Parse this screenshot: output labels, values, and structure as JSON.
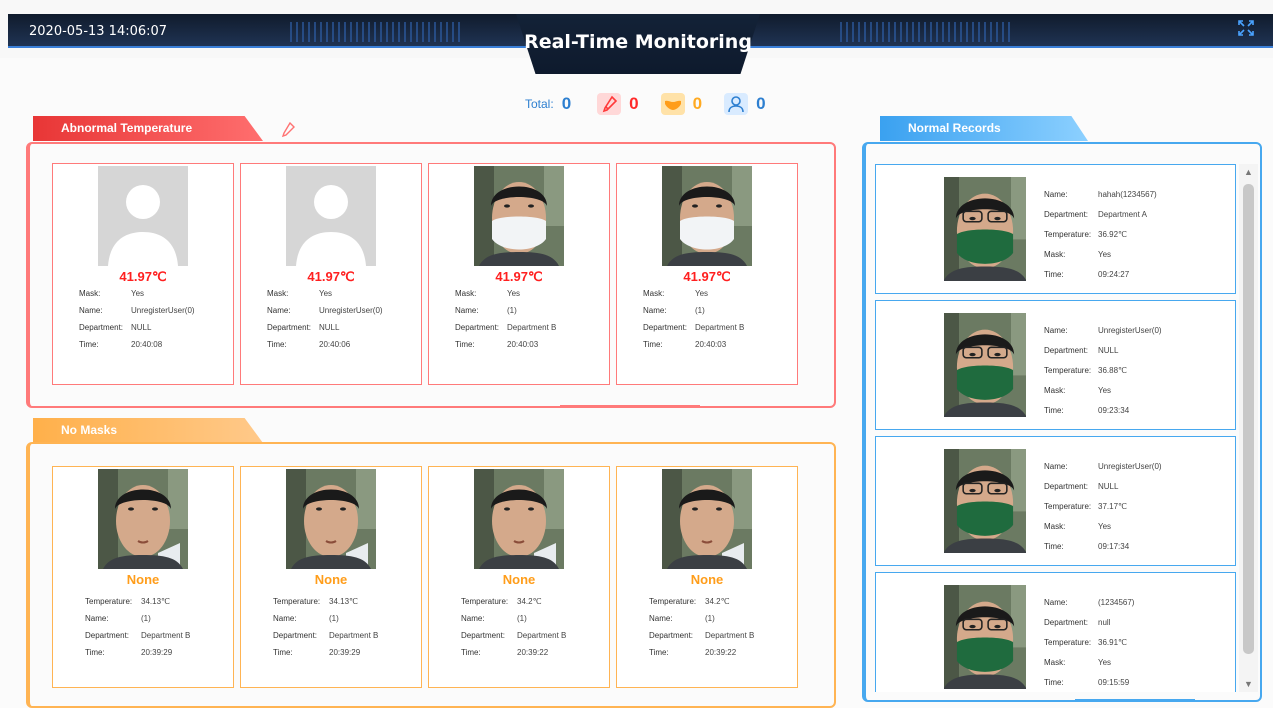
{
  "header": {
    "datetime": "2020-05-13 14:06:07",
    "title": "Real-Time Monitoring",
    "fullscreen_icon": "fullscreen-icon"
  },
  "summary": {
    "total_label": "Total:",
    "total_value": "0",
    "abnormal_temp_count": "0",
    "no_mask_count": "0",
    "stranger_count": "0",
    "colors": {
      "red": "#ff2a2a",
      "orange": "#ffaa22",
      "blue": "#2d7fd0"
    }
  },
  "abnormal": {
    "label": "Abnormal Temperature",
    "fields": {
      "mask": "Mask:",
      "name": "Name:",
      "department": "Department:",
      "time": "Time:"
    },
    "cards": [
      {
        "photo": "placeholder",
        "temperature": "41.97℃",
        "mask": "Yes",
        "name": "UnregisterUser(0)",
        "department": "NULL",
        "time": "20:40:08"
      },
      {
        "photo": "placeholder",
        "temperature": "41.97℃",
        "mask": "Yes",
        "name": "UnregisterUser(0)",
        "department": "NULL",
        "time": "20:40:06"
      },
      {
        "photo": "face-white-mask",
        "temperature": "41.97℃",
        "mask": "Yes",
        "name": "(1)",
        "department": "Department B",
        "time": "20:40:03"
      },
      {
        "photo": "face-white-mask",
        "temperature": "41.97℃",
        "mask": "Yes",
        "name": "(1)",
        "department": "Department B",
        "time": "20:40:03"
      }
    ]
  },
  "nomask": {
    "label": "No Masks",
    "fields": {
      "temperature": "Temperature:",
      "name": "Name:",
      "department": "Department:",
      "time": "Time:"
    },
    "cards": [
      {
        "photo": "face-no-mask",
        "status": "None",
        "temperature": "34.13℃",
        "name": "(1)",
        "department": "Department B",
        "time": "20:39:29"
      },
      {
        "photo": "face-no-mask",
        "status": "None",
        "temperature": "34.13℃",
        "name": "(1)",
        "department": "Department B",
        "time": "20:39:29"
      },
      {
        "photo": "face-no-mask",
        "status": "None",
        "temperature": "34.2℃",
        "name": "(1)",
        "department": "Department B",
        "time": "20:39:22"
      },
      {
        "photo": "face-no-mask",
        "status": "None",
        "temperature": "34.2℃",
        "name": "(1)",
        "department": "Department B",
        "time": "20:39:22"
      }
    ]
  },
  "normal": {
    "label": "Normal Records",
    "fields": {
      "name": "Name:",
      "department": "Department:",
      "temperature": "Temperature:",
      "mask": "Mask:",
      "time": "Time:"
    },
    "records": [
      {
        "photo": "face-green-mask",
        "name": "hahah(1234567)",
        "department": "Department A",
        "temperature": "36.92℃",
        "mask": "Yes",
        "time": "09:24:27"
      },
      {
        "photo": "face-green-mask",
        "name": "UnregisterUser(0)",
        "department": "NULL",
        "temperature": "36.88℃",
        "mask": "Yes",
        "time": "09:23:34"
      },
      {
        "photo": "face-green-mask",
        "name": "UnregisterUser(0)",
        "department": "NULL",
        "temperature": "37.17℃",
        "mask": "Yes",
        "time": "09:17:34"
      },
      {
        "photo": "face-green-mask",
        "name": "(1234567)",
        "department": "null",
        "temperature": "36.91℃",
        "mask": "Yes",
        "time": "09:15:59"
      }
    ]
  }
}
